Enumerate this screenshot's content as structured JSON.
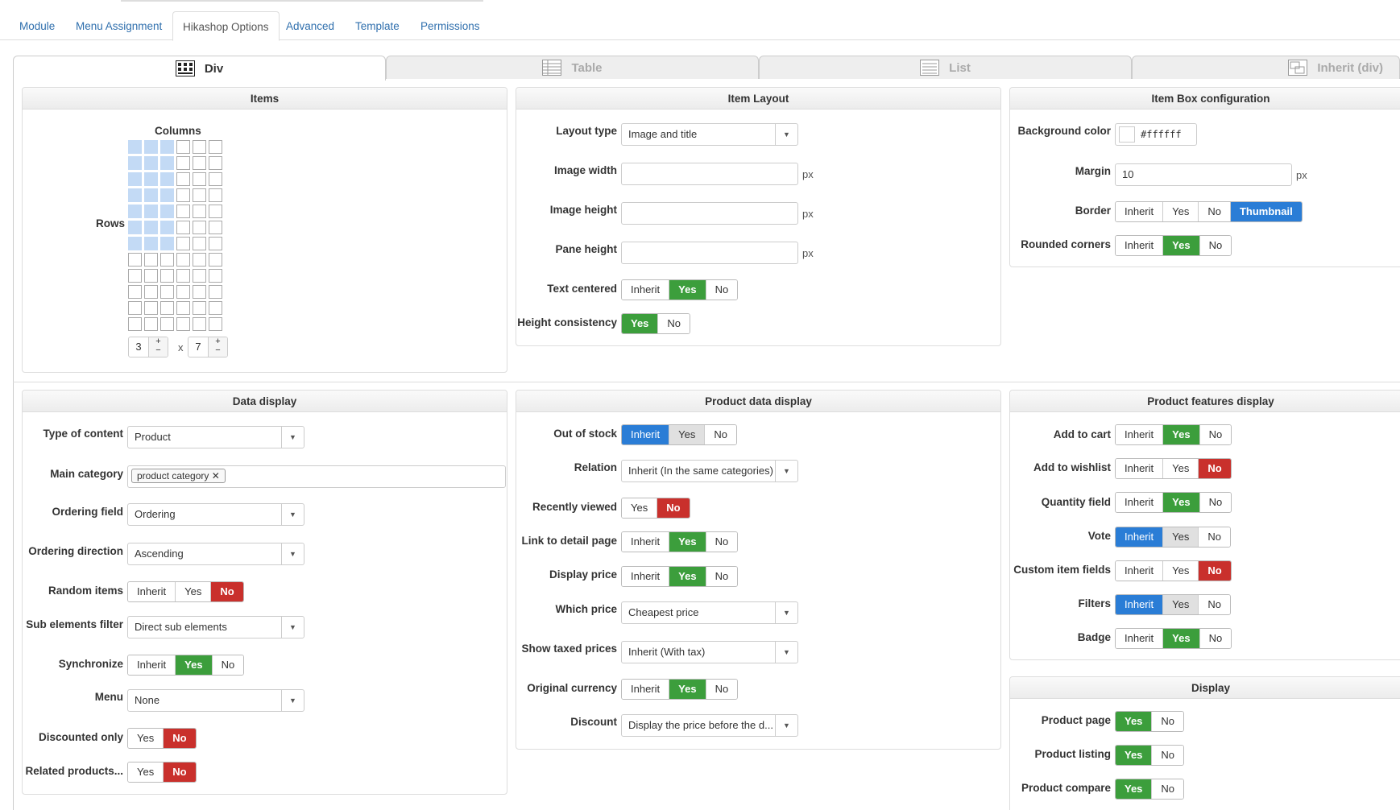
{
  "top_tabs": [
    "Module",
    "Menu Assignment",
    "Hikashop Options",
    "Advanced",
    "Template",
    "Permissions"
  ],
  "view_tabs": [
    "Div",
    "Table",
    "List",
    "Inherit (div)"
  ],
  "items": {
    "title": "Items",
    "columns_label": "Columns",
    "rows_label": "Rows",
    "columns_value": "3",
    "rows_value": "7",
    "times": "x",
    "plus": "+",
    "minus": "−"
  },
  "item_layout": {
    "title": "Item Layout",
    "layout_type_label": "Layout type",
    "layout_type_value": "Image and title",
    "image_width_label": "Image width",
    "image_height_label": "Image height",
    "pane_height_label": "Pane height",
    "px": "px",
    "text_centered_label": "Text centered",
    "height_consistency_label": "Height consistency"
  },
  "item_box": {
    "title": "Item Box configuration",
    "bg_label": "Background color",
    "bg_value": "#ffffff",
    "margin_label": "Margin",
    "margin_value": "10",
    "border_label": "Border",
    "rounded_label": "Rounded corners"
  },
  "btn": {
    "inherit": "Inherit",
    "yes": "Yes",
    "no": "No",
    "thumbnail": "Thumbnail"
  },
  "data_display": {
    "title": "Data display",
    "type_label": "Type of content",
    "type_value": "Product",
    "main_cat_label": "Main category",
    "main_cat_tag": "product category",
    "tag_x": "✕",
    "ordering_field_label": "Ordering field",
    "ordering_field_value": "Ordering",
    "ordering_dir_label": "Ordering direction",
    "ordering_dir_value": "Ascending",
    "random_label": "Random items",
    "sub_filter_label": "Sub elements filter",
    "sub_filter_value": "Direct sub elements",
    "sync_label": "Synchronize",
    "menu_label": "Menu",
    "menu_value": "None",
    "discounted_label": "Discounted only",
    "related_label": "Related products..."
  },
  "product_data": {
    "title": "Product data display",
    "out_stock_label": "Out of stock",
    "relation_label": "Relation",
    "relation_value": "Inherit (In the same categories)",
    "recent_label": "Recently viewed",
    "link_label": "Link to detail page",
    "display_price_label": "Display price",
    "which_price_label": "Which price",
    "which_price_value": "Cheapest price",
    "taxed_label": "Show taxed prices",
    "taxed_value": "Inherit (With tax)",
    "orig_cur_label": "Original currency",
    "discount_label": "Discount",
    "discount_value": "Display the price before the d..."
  },
  "features": {
    "title": "Product features display",
    "cart_label": "Add to cart",
    "wishlist_label": "Add to wishlist",
    "qty_label": "Quantity field",
    "vote_label": "Vote",
    "custom_label": "Custom item fields",
    "filters_label": "Filters",
    "badge_label": "Badge"
  },
  "display": {
    "title": "Display",
    "page_label": "Product page",
    "listing_label": "Product listing",
    "compare_label": "Product compare"
  },
  "colors": {
    "green": "#3c9e3c",
    "red": "#c9302c",
    "blue": "#2a7dd6",
    "link": "#2f6fad"
  },
  "icons": {
    "caret": "▼"
  }
}
